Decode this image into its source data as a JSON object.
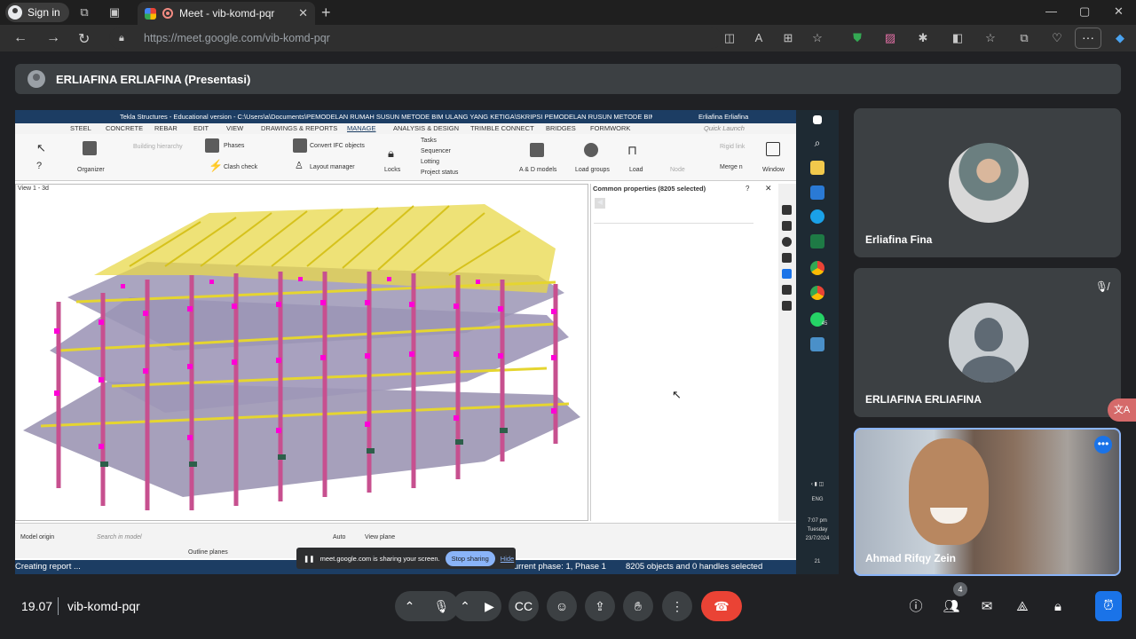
{
  "browser": {
    "signin_label": "Sign in",
    "tab_title": "Meet - vib-komd-pqr",
    "url": "https://meet.google.com/vib-komd-pqr"
  },
  "presenter_bar": {
    "label": "ERLIAFINA ERLIAFINA (Presentasi)"
  },
  "shared_screen": {
    "app_title": "Tekla Structures - Educational version - C:\\Users\\a\\Documents\\PEMODELAN RUMAH SUSUN METODE BIM ULANG YANG KETIGA\\SKRIPSI PEMODELAN RUSUN METODE BIM",
    "app_user": "Erliafina Erliafina",
    "menu_tabs": [
      "STEEL",
      "CONCRETE",
      "REBAR",
      "EDIT",
      "VIEW",
      "DRAWINGS & REPORTS",
      "MANAGE",
      "ANALYSIS & DESIGN",
      "TRIMBLE CONNECT",
      "BRIDGES",
      "FORMWORK"
    ],
    "quick_launch": "Quick Launch",
    "ribbon": {
      "organizer": "Organizer",
      "building_hierarchy": "Building hierarchy",
      "phases": "Phases",
      "clash_check": "Clash check",
      "convert_ifc": "Convert IFC objects",
      "layout_manager": "Layout manager",
      "locks": "Locks",
      "tasks": "Tasks",
      "sequencer": "Sequencer",
      "lotting": "Lotting",
      "project_status": "Project status",
      "ad_models": "A & D models",
      "load_groups": "Load groups",
      "load": "Load",
      "node": "Node",
      "rigid_link": "Rigid link",
      "merge_n": "Merge n",
      "window": "Window"
    },
    "view_title": "View 1 - 3d",
    "props_title": "Common properties (8205 selected)",
    "bottom_bar": {
      "model_origin": "Model origin",
      "search_in_model": "Search in model",
      "auto": "Auto",
      "view_plane": "View plane",
      "outline_planes": "Outline planes"
    },
    "status": {
      "left": "Creating report ...",
      "phase": "Current phase: 1, Phase 1",
      "objects": "8205 objects and 0 handles selected"
    },
    "share_notice": {
      "text": "meet.google.com is sharing your screen.",
      "stop": "Stop sharing",
      "hide": "Hide"
    },
    "taskbar": {
      "lang": "ENG",
      "time": "7:07 pm",
      "day": "Tuesday",
      "date": "23/7/2024",
      "whatsapp_count": "45",
      "notif_count": "21"
    }
  },
  "participants": [
    {
      "name": "Erliafina Fina"
    },
    {
      "name": "ERLIAFINA ERLIAFINA"
    },
    {
      "name": "Ahmad Rifqy Zein"
    }
  ],
  "footer": {
    "time": "19.07",
    "meeting_code": "vib-komd-pqr",
    "people_count": "4"
  },
  "colors": {
    "meet_bg": "#202124",
    "tile_bg": "#3c4043",
    "end_call": "#ea4335",
    "accent": "#1a73e8"
  }
}
